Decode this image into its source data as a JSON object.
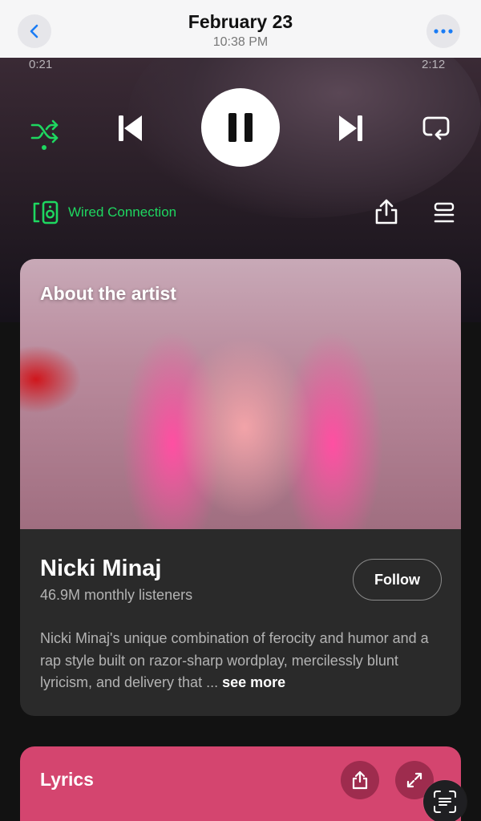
{
  "header": {
    "date": "February 23",
    "time": "10:38 PM"
  },
  "player": {
    "elapsed": "0:21",
    "duration": "2:12",
    "device_label": "Wired Connection",
    "accent_color": "#1ed760"
  },
  "artist_card": {
    "section_title": "About the artist",
    "name": "Nicki Minaj",
    "listeners": "46.9M monthly listeners",
    "follow_label": "Follow",
    "bio": "Nicki Minaj's unique combination of ferocity and humor and a rap style built on razor-sharp wordplay, mercilessly blunt lyricism, and delivery that ... ",
    "see_more": "see more"
  },
  "lyrics_card": {
    "title": "Lyrics",
    "color": "#d4456f"
  },
  "icons": [
    "chevron-left-icon",
    "ellipsis-icon",
    "shuffle-icon",
    "skip-back-icon",
    "pause-icon",
    "skip-forward-icon",
    "repeat-icon",
    "speaker-device-icon",
    "share-icon",
    "queue-icon",
    "expand-icon",
    "scan-text-icon"
  ]
}
